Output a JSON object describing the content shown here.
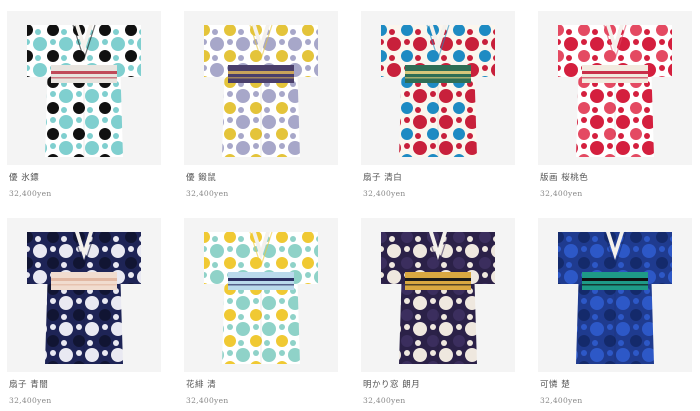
{
  "products": [
    {
      "name": "優 氷鏢",
      "price": "32,400yen",
      "colors": {
        "base": "#ffffff",
        "main": "#7fcfcf",
        "accent": "#111111",
        "obi": "#e8e4df",
        "obi_stripe": "#c04a5a"
      }
    },
    {
      "name": "優 鍛鼠",
      "price": "32,400yen",
      "colors": {
        "base": "#ffffff",
        "main": "#a7a7c9",
        "accent": "#e4c43a",
        "obi": "#4a3f6b",
        "obi_stripe": "#c9a35a"
      }
    },
    {
      "name": "扇子 清白",
      "price": "32,400yen",
      "colors": {
        "base": "#fbf6ee",
        "main": "#c8203b",
        "accent": "#1e8bc3",
        "obi": "#2f6e55",
        "obi_stripe": "#d7c77a"
      }
    },
    {
      "name": "版画 桜桃色",
      "price": "32,400yen",
      "colors": {
        "base": "#ffffff",
        "main": "#d41f3e",
        "accent": "#e44a62",
        "obi": "#f2eadf",
        "obi_stripe": "#c9304a"
      }
    },
    {
      "name": "扇子 青闇",
      "price": "32,400yen",
      "colors": {
        "base": "#1e2456",
        "main": "#e9e9f2",
        "accent": "#111533",
        "obi": "#f1dccf",
        "obi_stripe": "#e2b8a3"
      }
    },
    {
      "name": "花緋 清",
      "price": "32,400yen",
      "colors": {
        "base": "#ffffff",
        "main": "#8fd2c8",
        "accent": "#f0c933",
        "obi": "#b9d9ec",
        "obi_stripe": "#2b2e63"
      }
    },
    {
      "name": "明かり窓 朗月",
      "price": "32,400yen",
      "colors": {
        "base": "#2b2148",
        "main": "#efe8df",
        "accent": "#3b2e5e",
        "obi": "#d9a841",
        "obi_stripe": "#1a1a1a"
      }
    },
    {
      "name": "可憐 楚",
      "price": "32,400yen",
      "colors": {
        "base": "#1f3b8f",
        "main": "#2d58c7",
        "accent": "#142a6b",
        "obi": "#1e9a87",
        "obi_stripe": "#101010"
      }
    }
  ]
}
